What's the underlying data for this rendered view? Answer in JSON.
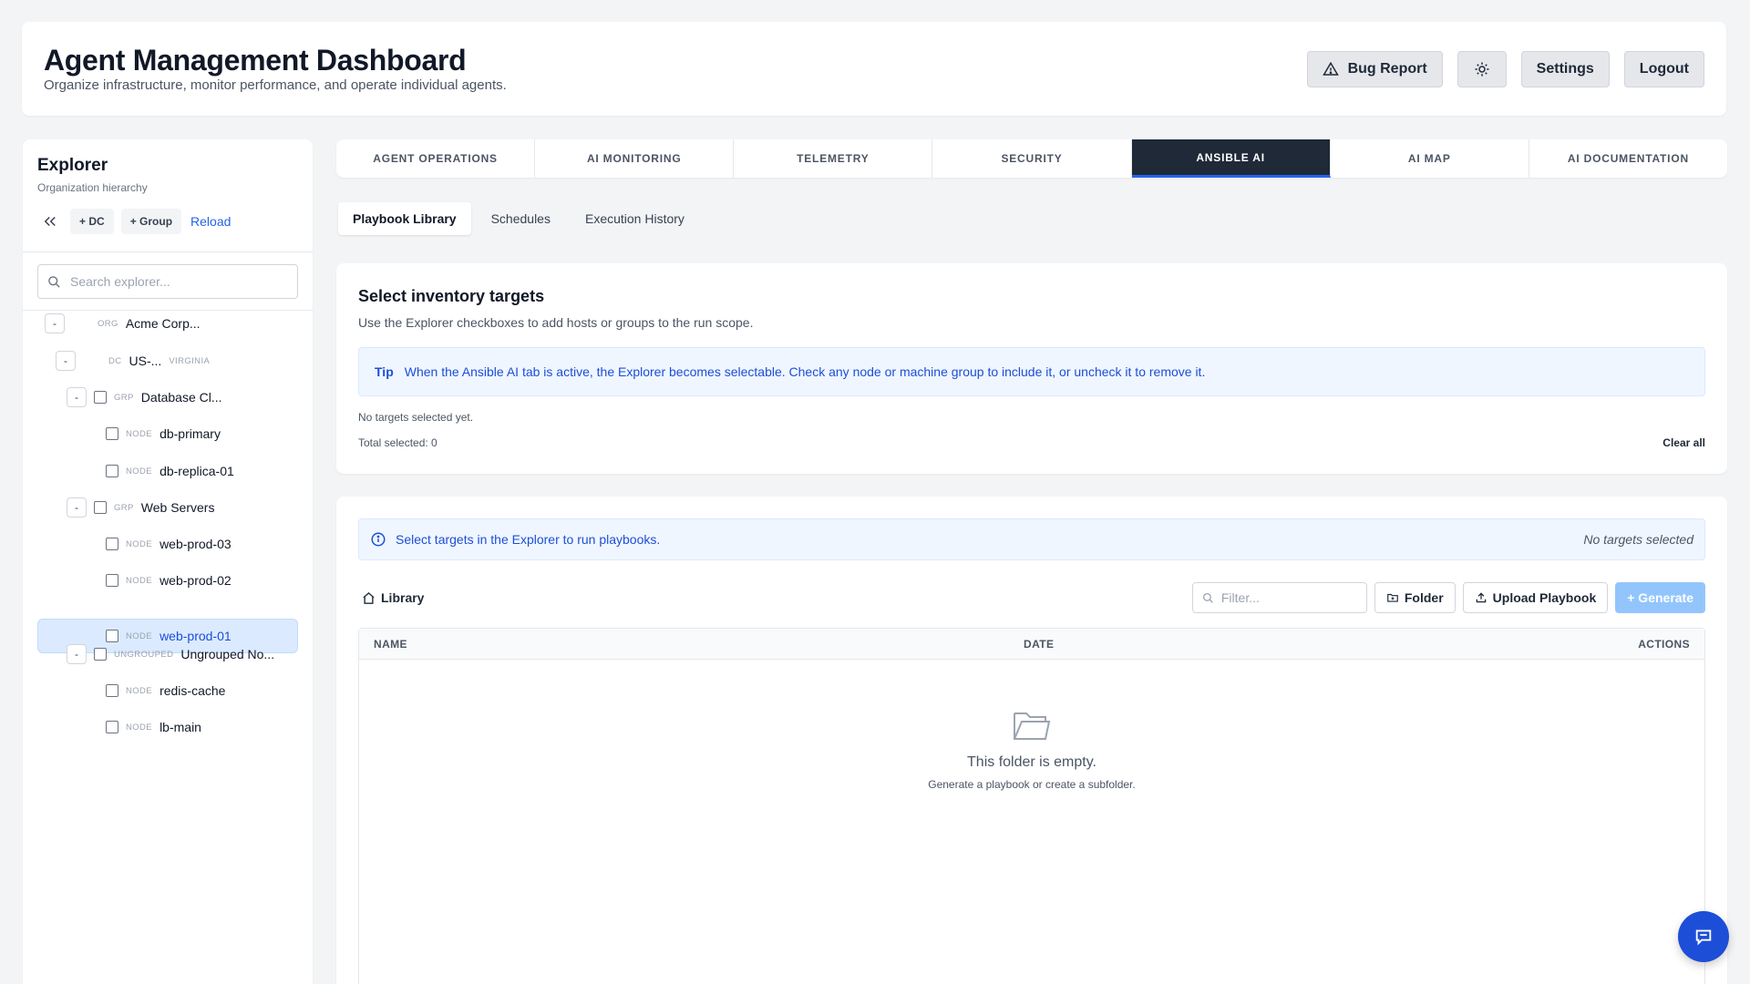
{
  "header": {
    "title": "Agent Management Dashboard",
    "subtitle": "Organize infrastructure, monitor performance, and operate individual agents.",
    "bug_report": "Bug Report",
    "settings": "Settings",
    "logout": "Logout"
  },
  "sidebar": {
    "title": "Explorer",
    "subtitle": "Organization hierarchy",
    "add_dc": "+ DC",
    "add_group": "+ Group",
    "reload": "Reload",
    "search_placeholder": "Search explorer...",
    "tree": [
      {
        "toggle": "-",
        "tag": "ORG",
        "name": "Acme Corp..."
      },
      {
        "toggle": "-",
        "tag": "DC",
        "name": "US-...",
        "location": "VIRGINIA"
      },
      {
        "toggle": "-",
        "tag": "GRP",
        "name": "Database Cl..."
      },
      {
        "tag": "NODE",
        "name": "db-primary"
      },
      {
        "tag": "NODE",
        "name": "db-replica-01"
      },
      {
        "toggle": "-",
        "tag": "GRP",
        "name": "Web Servers"
      },
      {
        "tag": "NODE",
        "name": "web-prod-03"
      },
      {
        "tag": "NODE",
        "name": "web-prod-02"
      },
      {
        "tag": "NODE",
        "name": "web-prod-01",
        "selected": true
      },
      {
        "toggle": "-",
        "tag": "UNGROUPED",
        "name": "Ungrouped No..."
      },
      {
        "tag": "NODE",
        "name": "redis-cache"
      },
      {
        "tag": "NODE",
        "name": "lb-main"
      }
    ]
  },
  "tabs": [
    {
      "label": "AGENT OPERATIONS"
    },
    {
      "label": "AI MONITORING"
    },
    {
      "label": "TELEMETRY"
    },
    {
      "label": "SECURITY"
    },
    {
      "label": "ANSIBLE AI",
      "active": true
    },
    {
      "label": "AI MAP"
    },
    {
      "label": "AI DOCUMENTATION"
    }
  ],
  "subtabs": [
    {
      "label": "Playbook Library",
      "active": true
    },
    {
      "label": "Schedules"
    },
    {
      "label": "Execution History"
    }
  ],
  "inventory": {
    "title": "Select inventory targets",
    "description": "Use the Explorer checkboxes to add hosts or groups to the run scope.",
    "tip_label": "Tip",
    "tip_text": "When the Ansible AI tab is active, the Explorer becomes selectable. Check any node or machine group to include it, or uncheck it to remove it.",
    "no_targets": "No targets selected yet.",
    "total": "Total selected: 0",
    "clear_all": "Clear all"
  },
  "library": {
    "info_text": "Select targets in the Explorer to run playbooks.",
    "info_status": "No targets selected",
    "title": "Library",
    "filter_placeholder": "Filter...",
    "folder_btn": "Folder",
    "upload_btn": "Upload Playbook",
    "generate_btn": "+ Generate",
    "columns": {
      "name": "NAME",
      "date": "DATE",
      "actions": "ACTIONS"
    },
    "empty_title": "This folder is empty.",
    "empty_sub": "Generate a playbook or create a subfolder."
  },
  "colors": {
    "accent": "#2563eb",
    "active_tab_bg": "#1f2937",
    "selected_row_bg": "#dbeafe"
  }
}
